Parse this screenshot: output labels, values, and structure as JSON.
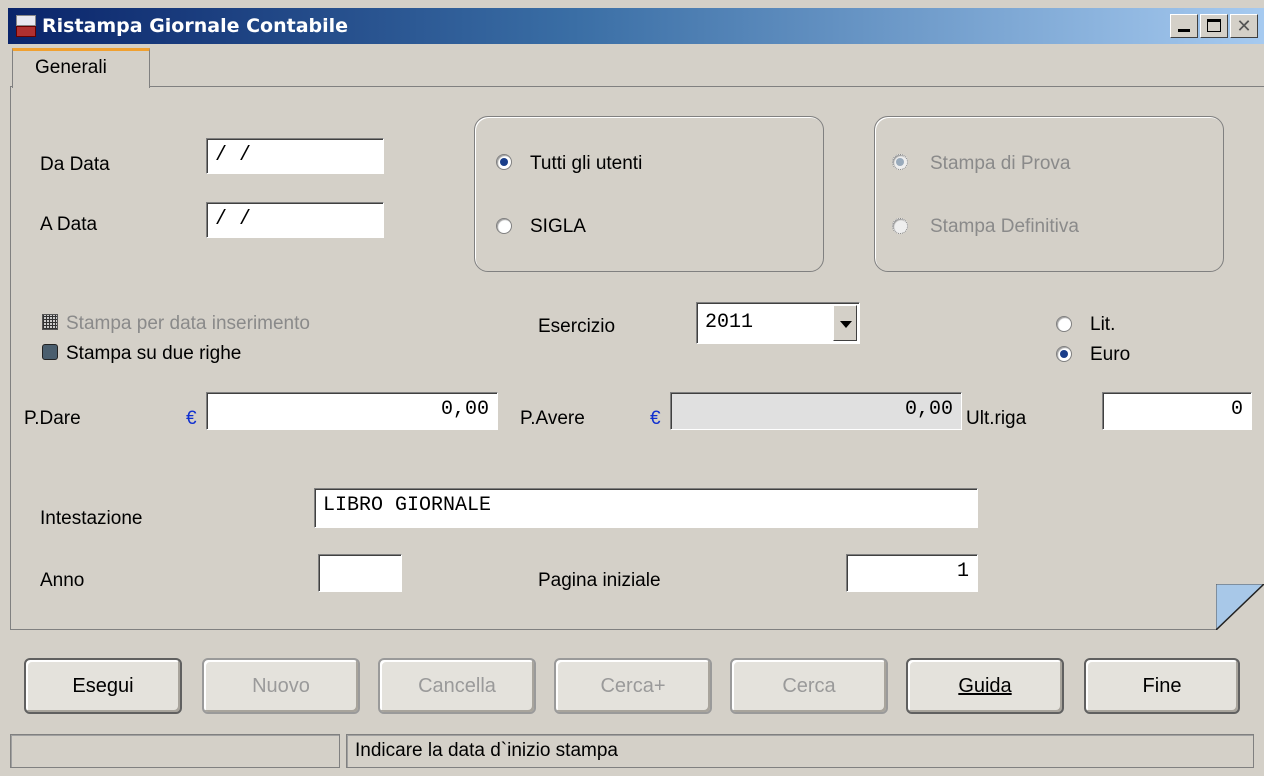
{
  "window": {
    "title": "Ristampa Giornale Contabile",
    "controls": {
      "minimize": "minimize-icon",
      "maximize": "maximize-icon",
      "close": "close-icon",
      "close_glyph": "✕"
    }
  },
  "tabs": [
    {
      "label": "Generali",
      "active": true
    }
  ],
  "form": {
    "da_data": {
      "label": "Da Data",
      "value": " /  /"
    },
    "a_data": {
      "label": "A Data",
      "value": " /  /"
    },
    "utenti": [
      {
        "label": "Tutti gli utenti",
        "checked": true
      },
      {
        "label": "SIGLA",
        "checked": false
      }
    ],
    "stampa_tipo": [
      {
        "label": "Stampa di Prova",
        "checked": true,
        "disabled": true
      },
      {
        "label": "Stampa Definitiva",
        "checked": false,
        "disabled": true
      }
    ],
    "stampa_per_data": {
      "label": "Stampa per data inserimento",
      "disabled": true
    },
    "stampa_due_righe": {
      "label": "Stampa su due righe"
    },
    "esercizio": {
      "label": "Esercizio",
      "value": "2011"
    },
    "valuta": [
      {
        "label": "Lit.",
        "checked": false
      },
      {
        "label": "Euro",
        "checked": true
      }
    ],
    "p_dare": {
      "label": "P.Dare",
      "currency": "€",
      "value": "0,00"
    },
    "p_avere": {
      "label": "P.Avere",
      "currency": "€",
      "value": "0,00"
    },
    "ult_riga": {
      "label": "Ult.riga",
      "value": "0"
    },
    "intestazione": {
      "label": "Intestazione",
      "value": "LIBRO GIORNALE"
    },
    "anno": {
      "label": "Anno",
      "value": ""
    },
    "pagina_iniziale": {
      "label": "Pagina iniziale",
      "value": "1"
    }
  },
  "buttons": [
    {
      "label": "Esegui",
      "enabled": true
    },
    {
      "label": "Nuovo",
      "enabled": false
    },
    {
      "label": "Cancella",
      "enabled": false
    },
    {
      "label": "Cerca+",
      "enabled": false
    },
    {
      "label": "Cerca",
      "enabled": false
    },
    {
      "label": "Guida",
      "enabled": true
    },
    {
      "label": "Fine",
      "enabled": true
    }
  ],
  "status": {
    "left": "",
    "message": "Indicare la data d`inizio stampa"
  },
  "colors": {
    "titlebar_start": "#0a246a",
    "titlebar_end": "#a6caf0",
    "tab_accent": "#f0a030",
    "window_bg": "#d4d0c8",
    "euro_color": "#1030d0"
  }
}
